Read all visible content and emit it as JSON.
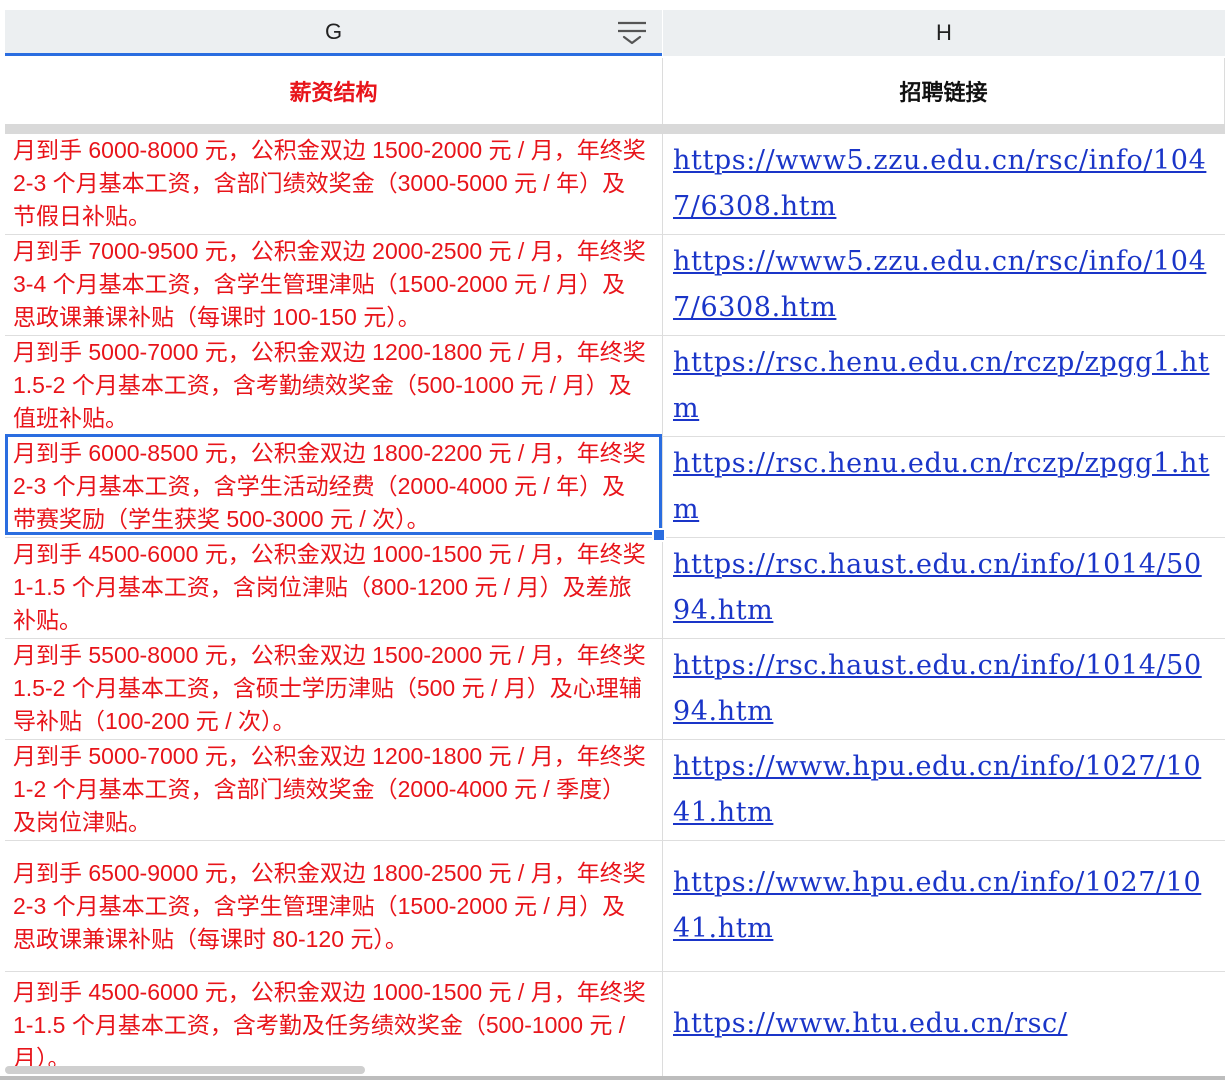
{
  "columns": {
    "g": {
      "letter": "G",
      "header": "薪资结构"
    },
    "h": {
      "letter": "H",
      "header": "招聘链接"
    }
  },
  "colors": {
    "salary_text": "#e8141a",
    "link": "#1a35c8",
    "selection": "#2a6de0"
  },
  "rows": [
    {
      "salary": "月到手 6000-8000 元，公积金双边 1500-2000 元 / 月，年终奖 2-3 个月基本工资，含部门绩效奖金（3000-5000 元 / 年）及节假日补贴。",
      "link": "https://www5.zzu.edu.cn/rsc/info/1047/6308.htm"
    },
    {
      "salary": "月到手 7000-9500 元，公积金双边 2000-2500 元 / 月，年终奖 3-4 个月基本工资，含学生管理津贴（1500-2000 元 / 月）及思政课兼课补贴（每课时 100-150 元）。",
      "link": "https://www5.zzu.edu.cn/rsc/info/1047/6308.htm"
    },
    {
      "salary": "月到手 5000-7000 元，公积金双边 1200-1800 元 / 月，年终奖 1.5-2 个月基本工资，含考勤绩效奖金（500-1000 元 / 月）及值班补贴。",
      "link": "https://rsc.henu.edu.cn/rczp/zpgg1.htm"
    },
    {
      "salary": "月到手 6000-8500 元，公积金双边 1800-2200 元 / 月，年终奖 2-3 个月基本工资，含学生活动经费（2000-4000 元 / 年）及带赛奖励（学生获奖 500-3000 元 / 次）。",
      "link": "https://rsc.henu.edu.cn/rczp/zpgg1.htm"
    },
    {
      "salary": "月到手 4500-6000 元，公积金双边 1000-1500 元 / 月，年终奖 1-1.5 个月基本工资，含岗位津贴（800-1200 元 / 月）及差旅补贴。",
      "link": "https://rsc.haust.edu.cn/info/1014/5094.htm"
    },
    {
      "salary": "月到手 5500-8000 元，公积金双边 1500-2000 元 / 月，年终奖 1.5-2 个月基本工资，含硕士学历津贴（500 元 / 月）及心理辅导补贴（100-200 元 / 次）。",
      "link": "https://rsc.haust.edu.cn/info/1014/5094.htm"
    },
    {
      "salary": "月到手 5000-7000 元，公积金双边 1200-1800 元 / 月，年终奖 1-2 个月基本工资，含部门绩效奖金（2000-4000 元 / 季度）及岗位津贴。",
      "link": "https://www.hpu.edu.cn/info/1027/1041.htm"
    },
    {
      "salary": "月到手 6500-9000 元，公积金双边 1800-2500 元 / 月，年终奖 2-3 个月基本工资，含学生管理津贴（1500-2000 元 / 月）及思政课兼课补贴（每课时 80-120 元）。",
      "link": "https://www.hpu.edu.cn/info/1027/1041.htm"
    },
    {
      "salary": "月到手 4500-6000 元，公积金双边 1000-1500 元 / 月，年终奖 1-1.5 个月基本工资，含考勤及任务绩效奖金（500-1000 元 / 月）。",
      "link": "https://www.htu.edu.cn/rsc/"
    }
  ]
}
